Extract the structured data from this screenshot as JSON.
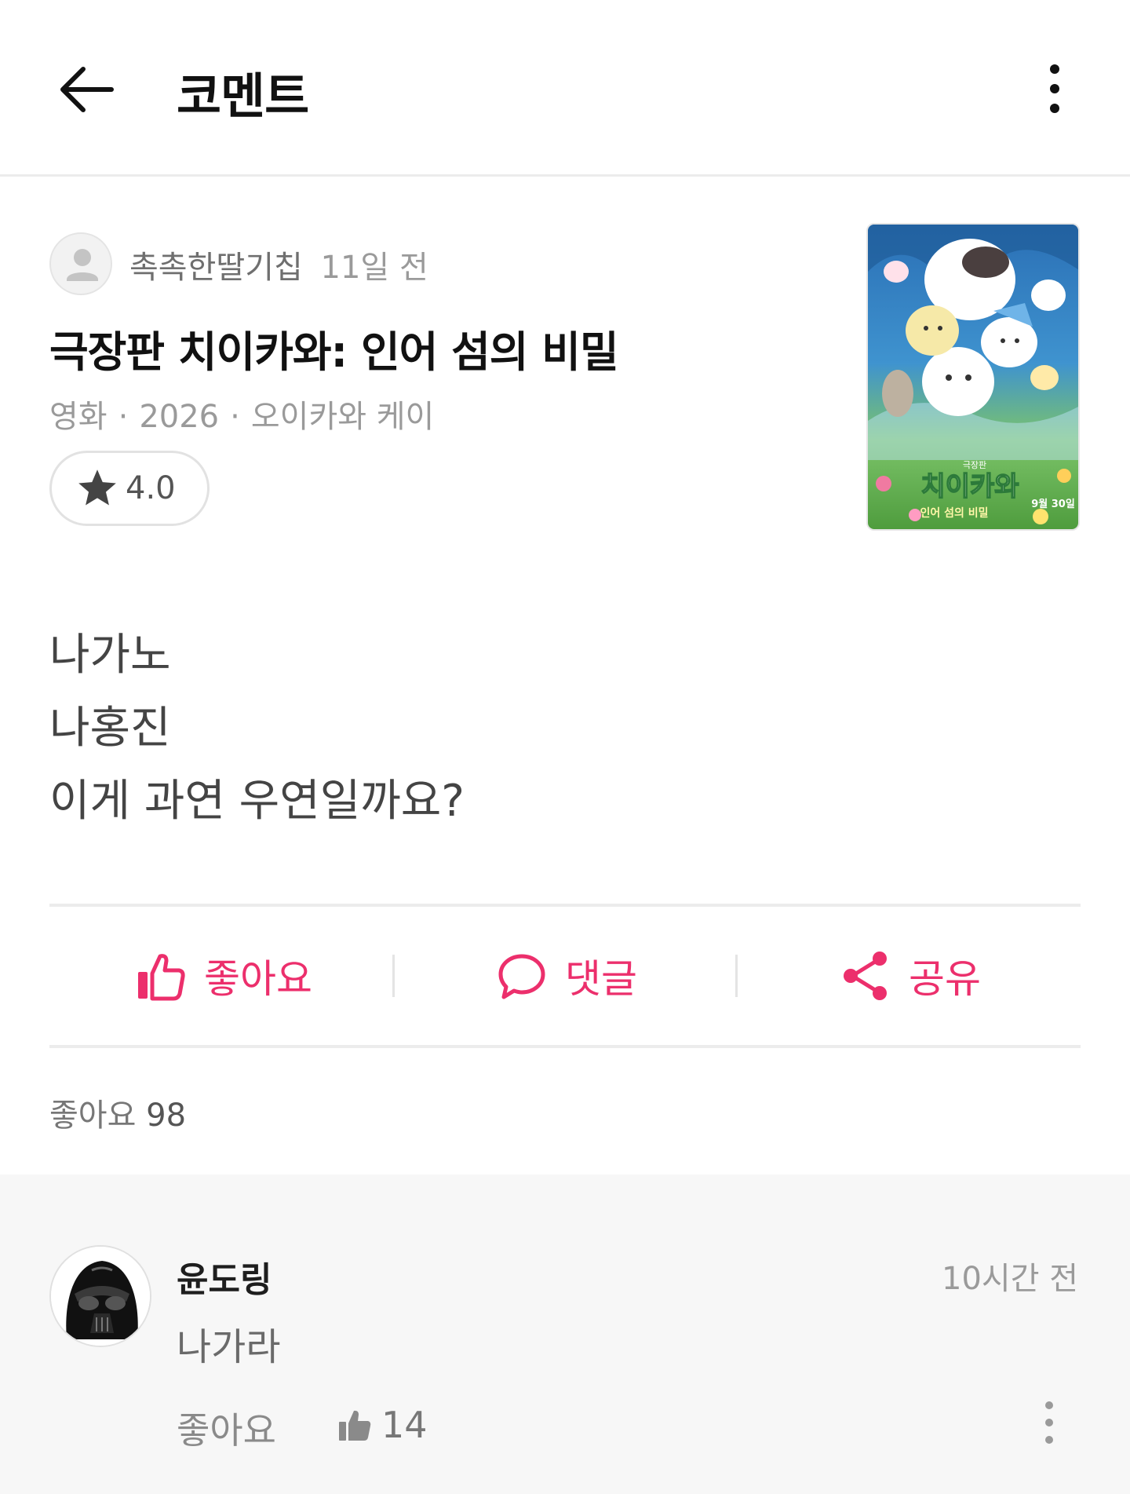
{
  "header": {
    "title": "코멘트",
    "back_icon": "arrow-left-icon",
    "more_icon": "more-vertical-icon"
  },
  "comment": {
    "author": "촉촉한딸기칩",
    "time": "11일 전",
    "movie_title": "극장판 치이카와: 인어 섬의 비밀",
    "meta": {
      "category": "영화",
      "year": "2026",
      "director": "오이카와 케이",
      "separator": "·"
    },
    "rating": "4.0",
    "body_lines": [
      "나가노",
      "나홍진",
      "이게 과연 우연일까요?"
    ],
    "poster": {
      "title_text": "치이카와",
      "subtitle_text": "인어 섬의 비밀",
      "small_text": "극장판",
      "date_text": "9월 30일"
    }
  },
  "actions": {
    "like": "좋아요",
    "reply": "댓글",
    "share": "공유"
  },
  "like_summary": {
    "label": "좋아요",
    "count": "98"
  },
  "reply": {
    "name": "윤도링",
    "time": "10시간 전",
    "text": "나가라",
    "like_label": "좋아요",
    "like_count": "14"
  },
  "colors": {
    "accent": "#ec2f6c",
    "reply_bg": "#f7f7f7",
    "divider": "#ececec"
  }
}
